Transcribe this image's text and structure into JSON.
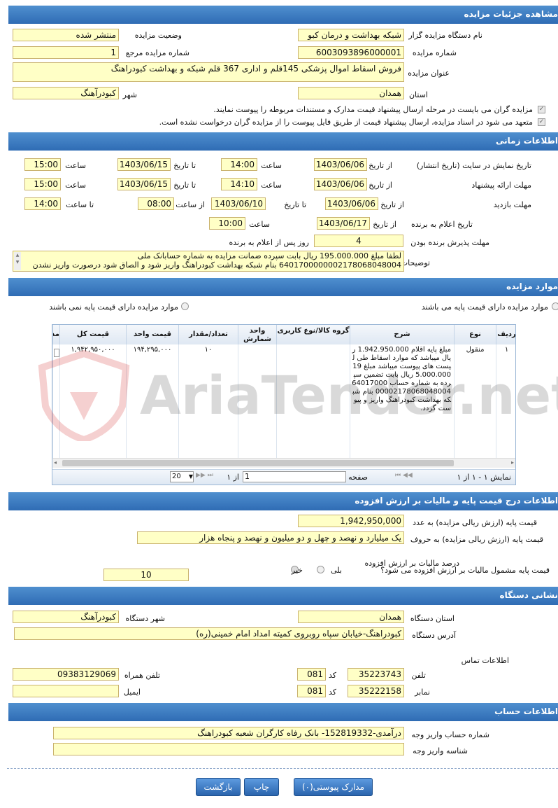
{
  "sections": {
    "details": "مشاهده جزئیات مزایده",
    "time": "اطلاعات زمانی",
    "items": "موارد مزایده",
    "price": "اطلاعات درج قیمت پایه و مالیات بر ارزش افزوده",
    "address": "نشانی دستگاه",
    "account": "اطلاعات حساب"
  },
  "details": {
    "org_label": "نام دستگاه مزایده گزار",
    "org_value": "شبکه بهداشت و درمان کبو",
    "status_label": "وضعیت مزایده",
    "status_value": "منتشر شده",
    "number_label": "شماره مزایده",
    "number_value": "6003093896000001",
    "ref_label": "شماره مزایده مرجع",
    "ref_value": "1",
    "title_label": "عنوان مزایده",
    "title_value": "فروش اسقاط اموال پزشکی 145قلم و اداری  367 قلم شبکه و بهداشت کبودراهنگ",
    "province_label": "استان",
    "province_value": "همدان",
    "city_label": "شهر",
    "city_value": "کبودرآهنگ",
    "check1": "مزایده گران می بایست در مرحله ارسال پیشنهاد قیمت مدارک و مستندات مربوطه را پیوست نمایند.",
    "check2": "متعهد می شود در اسناد مزایده، ارسال پیشنهاد قیمت از طریق فایل پیوست را از مزایده گران درخواست نشده است."
  },
  "time": {
    "display_label": "تاریخ نمایش در سایت (تاریخ انتشار)",
    "from_date_label": "از تاریخ",
    "to_date_label": "تا تاریخ",
    "hour_label": "ساعت",
    "display_from_date": "1403/06/06",
    "display_from_time": "14:00",
    "display_to_date": "1403/06/15",
    "display_to_time": "15:00",
    "offer_label": "مهلت ارائه پیشنهاد",
    "offer_from_date": "1403/06/06",
    "offer_from_time": "14:10",
    "offer_to_date": "1403/06/15",
    "offer_to_time": "15:00",
    "visit_label": "مهلت بازدید",
    "visit_from_date": "1403/06/06",
    "visit_to_date": "1403/06/10",
    "from_hour_label": "از ساعت",
    "to_hour_label": "تا ساعت",
    "visit_from_time": "08:00",
    "visit_to_time": "14:00",
    "announce_label": "تاریخ اعلام به برنده",
    "announce_date": "1403/06/17",
    "announce_time": "10:00",
    "accept_label": "مهلت پذیرش برنده بودن",
    "accept_value": "4",
    "accept_suffix": "روز پس از اعلام به برنده",
    "desc_label": "توضیحات",
    "desc_line1": "لطفا مبلغ 195.000.000 ریال بابت سپرده ضمانت مزایده به شماره حسابانک ملی",
    "desc_line2": "6401700000002178068048004 بنام شبکه بهداشت کبودراهنگ واریز شود و الصاق شود درصورت واریز نشدن"
  },
  "items": {
    "radio_has_base": "موارد مزایده دارای قیمت پایه می باشند",
    "radio_no_base": "موارد مزایده دارای قیمت پایه نمی باشند",
    "columns": [
      "ردیف",
      "نوع",
      "شرح",
      "گروه کالا/نوع کاربری",
      "واحد شمارش",
      "تعداد/مقدار",
      "قیمت واحد",
      "قیمت کل",
      "مد"
    ],
    "row": {
      "index": "۱",
      "type": "منقول",
      "desc": "مبلغ پایه اقلام 1.942.950.000 ریال میباشد که موارد اسقاط طی لیست های پیوست میباشد مبلغ 195.000.000 ریال بابت تضمین سپرده به شماره حساب 6401700000002178068048004 بنام شبکه بهداشت کبودراهنگ واریز و پیوست گردد.",
      "qty": "۱۰",
      "unit_price": "۱۹۴,۲۹۵,۰۰۰",
      "total": "۱,۹۴۲,۹۵۰,۰۰۰"
    },
    "page_label": "صفحه",
    "page_value": "1",
    "of_label": "از ۱",
    "page_size": "20",
    "showing": "نمایش ۱ - ۱ از ۱",
    "watermark": "AriaTender.net"
  },
  "price": {
    "base_num_label": "قیمت پایه (ارزش ریالی مزایده) به عدد",
    "base_num_value": "1,942,950,000",
    "base_text_label": "قیمت پایه (ارزش ریالی مزایده) به حروف",
    "base_text_value": "یک میلیارد و نهصد و چهل و دو میلیون و نهصد و پنجاه هزار",
    "vat_q_label": "قیمت پایه مشمول مالیات بر ارزش افزوده می شود؟",
    "yes_label": "بلی",
    "no_label": "خیر",
    "vat_pct_label": "درصد مالیات بر ارزش افزوده",
    "vat_pct_value": "10"
  },
  "address": {
    "province_label": "استان دستگاه",
    "province_value": "همدان",
    "city_label": "شهر دستگاه",
    "city_value": "کبودرآهنگ",
    "addr_label": "آدرس دستگاه",
    "addr_value": "کبودراهنگ-خیابان سپاه روبروی کمیته امداد امام خمینی(ره)",
    "contact_label": "اطلاعات تماس",
    "phone_label": "تلفن",
    "code_label": "کد",
    "phone_value": "35223743",
    "phone_code": "081",
    "mobile_label": "تلفن همراه",
    "mobile_value": "09383129069",
    "fax_label": "نمابر",
    "fax_value": "35222158",
    "fax_code": "081",
    "email_label": "ایمیل",
    "email_value": ""
  },
  "account": {
    "acc_label": "شماره حساب واریز وجه",
    "acc_value": "درآمدی-152819332- بانک رفاه کارگران شعبه کبودراهنگ",
    "id_label": "شناسه واریز وجه",
    "id_value": ""
  },
  "buttons": {
    "docs": "مدارک پیوستی(۰)",
    "print": "چاپ",
    "back": "بازگشت"
  }
}
